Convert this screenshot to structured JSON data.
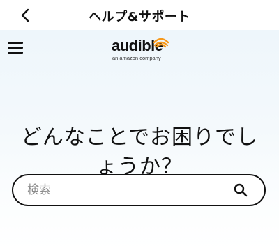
{
  "topbar": {
    "title": "ヘルプ&サポート",
    "back_icon": "chevron-left-icon"
  },
  "header": {
    "menu_icon": "hamburger-menu-icon",
    "logo": {
      "word": "audible",
      "subtitle": "an amazon company",
      "accent_color": "#f7991c"
    }
  },
  "main": {
    "headline_line1": "どんなことでお困りでし",
    "headline_line2": "ょうか？",
    "search": {
      "placeholder": "検索",
      "value": "",
      "icon": "search-icon"
    }
  },
  "colors": {
    "background_top": "#eef6fb",
    "text": "#111111",
    "accent": "#f7991c"
  }
}
